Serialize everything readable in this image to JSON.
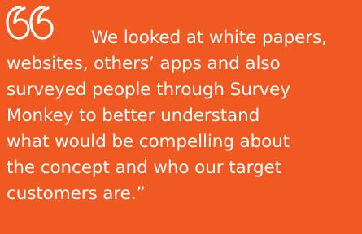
{
  "quote": {
    "icon": "open-quote-icon",
    "lines": [
      "We looked at white papers,",
      "websites, others’ apps and also",
      "surveyed people through Survey",
      "Monkey to better understand",
      "what would be compelling about",
      "the concept and who our target",
      "customers are.”"
    ]
  },
  "colors": {
    "background": "#f05a22",
    "text": "#ffffff"
  }
}
